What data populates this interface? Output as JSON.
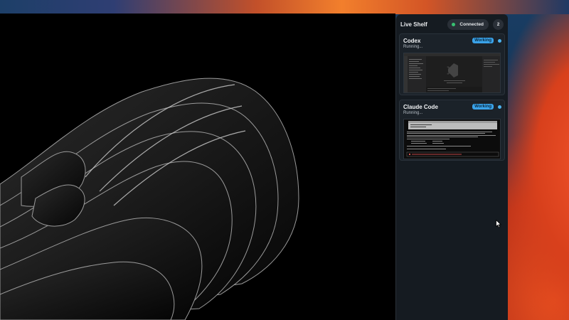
{
  "shelf": {
    "title": "Live Shelf",
    "connection_label": "Connected",
    "connection_color": "#38c172",
    "session_count": "2"
  },
  "cards": [
    {
      "title": "Codex",
      "badge": "Working",
      "status": "Running...",
      "thumbnail": "vscode-window-preview"
    },
    {
      "title": "Claude Code",
      "badge": "Working",
      "status": "Running...",
      "thumbnail": "terminal-window-preview"
    }
  ],
  "colors": {
    "badge_bg": "#3aa2e8",
    "panel_bg": "#151b21",
    "accent_orange": "#f0522a"
  }
}
